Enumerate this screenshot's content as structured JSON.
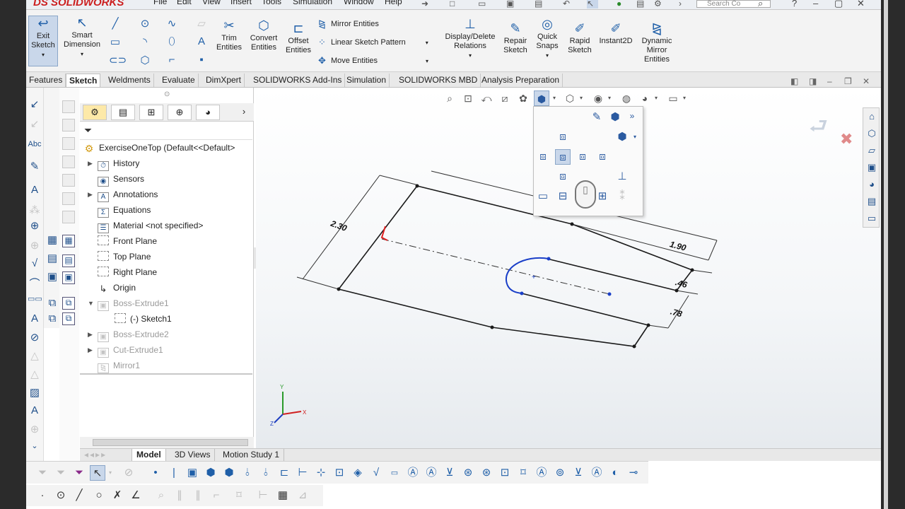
{
  "app": {
    "logo_text": "DS SOLIDWORKS"
  },
  "menu": [
    "File",
    "Edit",
    "View",
    "Insert",
    "Tools",
    "Simulation",
    "Window",
    "Help"
  ],
  "search_placeholder": "Search Co",
  "command_manager": {
    "exit_sketch": "Exit Sketch",
    "smart_dimension": "Smart Dimension",
    "trim_entities": "Trim Entities",
    "convert_entities": "Convert Entities",
    "offset_entities": "Offset Entities",
    "mirror_entities": "Mirror Entities",
    "linear_sketch_pattern": "Linear Sketch Pattern",
    "move_entities": "Move Entities",
    "display_delete_relations": "Display/Delete Relations",
    "repair_sketch": "Repair Sketch",
    "quick_snaps": "Quick Snaps",
    "rapid_sketch": "Rapid Sketch",
    "instant2d": "Instant2D",
    "dynamic_mirror": "Dynamic Mirror Entities"
  },
  "tabs": [
    "Features",
    "Sketch",
    "Weldments",
    "Evaluate",
    "DimXpert",
    "SOLIDWORKS Add-Ins",
    "Simulation",
    "SOLIDWORKS MBD",
    "Analysis Preparation"
  ],
  "active_tab": "Sketch",
  "feature_tree": {
    "root": "ExerciseOneTop  (Default<<Default>",
    "items": [
      {
        "label": "History",
        "expandable": true,
        "dim": false
      },
      {
        "label": "Sensors",
        "expandable": false,
        "dim": false
      },
      {
        "label": "Annotations",
        "expandable": true,
        "dim": false
      },
      {
        "label": "Equations",
        "expandable": false,
        "dim": false
      },
      {
        "label": "Material <not specified>",
        "expandable": false,
        "dim": false
      },
      {
        "label": "Front Plane",
        "expandable": false,
        "dim": false
      },
      {
        "label": "Top Plane",
        "expandable": false,
        "dim": false
      },
      {
        "label": "Right Plane",
        "expandable": false,
        "dim": false
      },
      {
        "label": "Origin",
        "expandable": false,
        "dim": false
      },
      {
        "label": "Boss-Extrude1",
        "expandable": true,
        "dim": true
      },
      {
        "label": "(-) Sketch1",
        "expandable": false,
        "dim": false
      },
      {
        "label": "Boss-Extrude2",
        "expandable": true,
        "dim": true
      },
      {
        "label": "Cut-Extrude1",
        "expandable": true,
        "dim": true
      },
      {
        "label": "Mirror1",
        "expandable": false,
        "dim": true
      }
    ]
  },
  "bottom_tabs": [
    "Model",
    "3D Views",
    "Motion Study 1"
  ],
  "active_bottom_tab": "Model",
  "dimensions": {
    "d1": "2.30",
    "d2": "1.90",
    "d3": ".46",
    "d4": ".78"
  },
  "triad": {
    "x": "X",
    "y": "Y",
    "z": "Z"
  },
  "colors": {
    "accent": "#1f5fa8",
    "sketch_line": "#1a1a1a",
    "arc": "#1a3fc8",
    "relation": "#e02020",
    "logo": "#cc1f1f"
  }
}
